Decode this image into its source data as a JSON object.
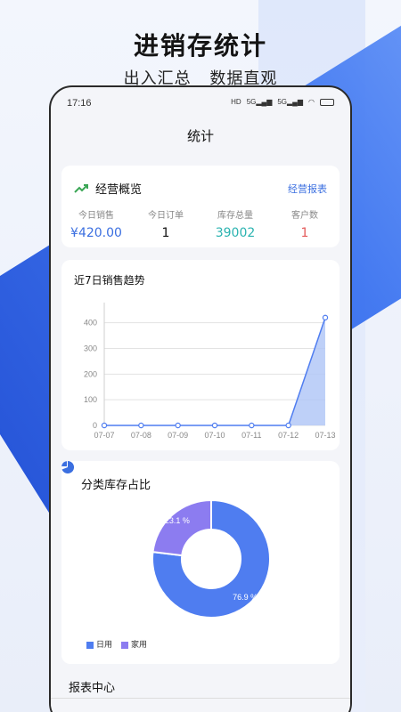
{
  "promo": {
    "title": "进销存统计",
    "subtitle": "出入汇总   数据直观"
  },
  "status": {
    "time": "17:16",
    "icons": [
      "hd-icon",
      "signal-5g-icon",
      "signal-5g-icon",
      "wifi-icon",
      "battery-icon"
    ]
  },
  "page": {
    "title": "统计"
  },
  "overview": {
    "title": "经营概览",
    "link": "经营报表",
    "icon": "trend-up-icon",
    "kpis": [
      {
        "label": "今日销售",
        "value": "¥420.00"
      },
      {
        "label": "今日订单",
        "value": "1"
      },
      {
        "label": "库存总量",
        "value": "39002"
      },
      {
        "label": "客户数",
        "value": "1"
      }
    ]
  },
  "trend": {
    "title": "近7日销售趋势"
  },
  "category": {
    "title": "分类库存占比",
    "icon": "pie-chart-icon"
  },
  "report": {
    "title": "报表中心"
  },
  "colors": {
    "accent": "#3b6fe0",
    "stock": "#2bb3b0",
    "customers": "#e45a5a",
    "series_daily": "#4f7df0",
    "series_home": "#8c7cf0"
  },
  "chart_data": [
    {
      "type": "area",
      "title": "近7日销售趋势",
      "categories": [
        "07-07",
        "07-08",
        "07-09",
        "07-10",
        "07-11",
        "07-12",
        "07-13"
      ],
      "values": [
        0,
        0,
        0,
        0,
        0,
        0,
        420
      ],
      "yticks": [
        0,
        100,
        200,
        300,
        400
      ],
      "ylim": [
        0,
        430
      ],
      "grid": true
    },
    {
      "type": "pie",
      "title": "分类库存占比",
      "series": [
        {
          "name": "日用",
          "value": 76.9,
          "label": "76.9 %"
        },
        {
          "name": "家用",
          "value": 23.1,
          "label": "23.1 %"
        }
      ],
      "donut": true,
      "legend": "bottom-left"
    }
  ]
}
